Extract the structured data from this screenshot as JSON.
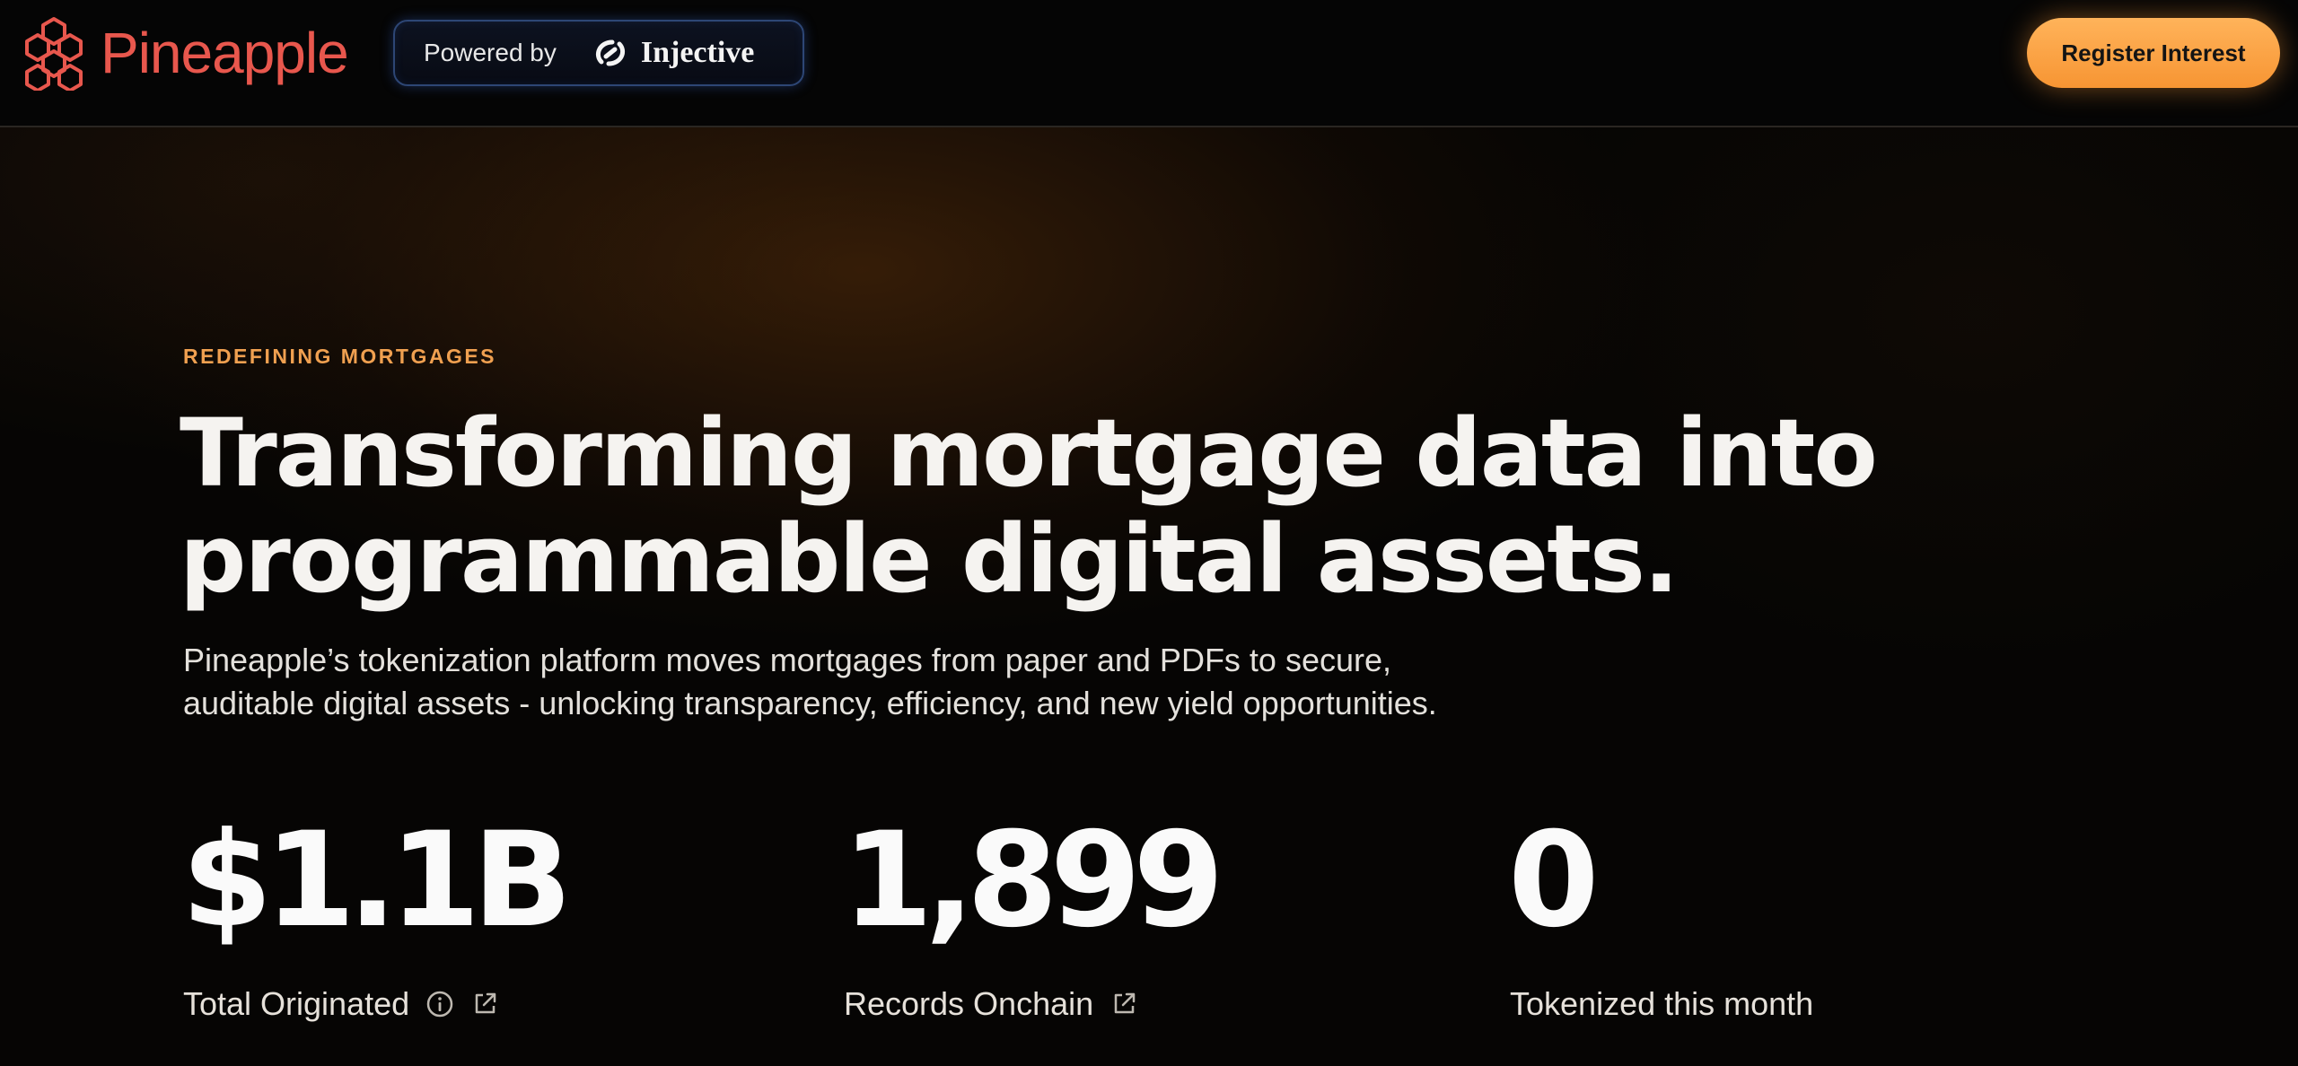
{
  "header": {
    "logo_text": "Pineapple",
    "logo_icon": "hexagon-cluster-icon",
    "powered_by": "Powered by",
    "partner_name": "Injective",
    "partner_icon": "injective-logo-icon",
    "cta_label": "Register Interest"
  },
  "hero": {
    "eyebrow": "REDEFINING MORTGAGES",
    "headline_line1": "Transforming mortgage data into",
    "headline_line2": "programmable digital assets.",
    "subtext_line1": "Pineapple’s tokenization platform moves mortgages from paper and PDFs to secure,",
    "subtext_line2": "auditable digital assets - unlocking transparency, efficiency, and new yield opportunities."
  },
  "stats": [
    {
      "value": "$1.1B",
      "label": "Total Originated",
      "icons": [
        "info-icon",
        "external-link-icon"
      ]
    },
    {
      "value": "1,899",
      "label": "Records Onchain",
      "icons": [
        "external-link-icon"
      ]
    },
    {
      "value": "0",
      "label": "Tokenized this month",
      "icons": []
    }
  ],
  "colors": {
    "brand": "#e8574d",
    "accent_orange": "#f79533",
    "eyebrow": "#f0a050",
    "background": "#060504"
  }
}
